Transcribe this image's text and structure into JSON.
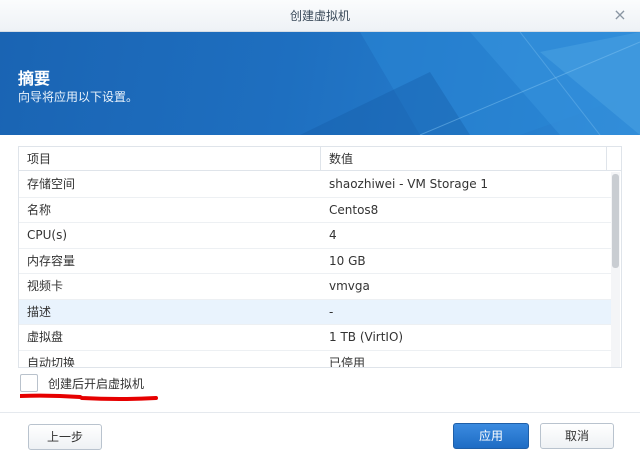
{
  "window": {
    "title": "创建虚拟机",
    "close_icon": "close-icon"
  },
  "banner": {
    "heading": "摘要",
    "subtitle": "向导将应用以下设置。"
  },
  "table": {
    "columns": [
      "项目",
      "数值"
    ],
    "rows": [
      {
        "item": "存储空间",
        "value": "shaozhiwei - VM Storage 1"
      },
      {
        "item": "名称",
        "value": "Centos8"
      },
      {
        "item": "CPU(s)",
        "value": "4"
      },
      {
        "item": "内存容量",
        "value": "10 GB"
      },
      {
        "item": "视频卡",
        "value": "vmvga"
      },
      {
        "item": "描述",
        "value": "-"
      },
      {
        "item": "虚拟盘",
        "value": "1 TB (VirtIO)"
      },
      {
        "item": "自动切换",
        "value": "已停用"
      }
    ],
    "selected_row": 5
  },
  "checkbox": {
    "label": "创建后开启虚拟机",
    "checked": false
  },
  "buttons": {
    "back": "上一步",
    "apply": "应用",
    "cancel": "取消"
  },
  "colors": {
    "banner": "#1e6fc0",
    "primary_button": "#2a7ad4",
    "annotation": "#e60000"
  }
}
